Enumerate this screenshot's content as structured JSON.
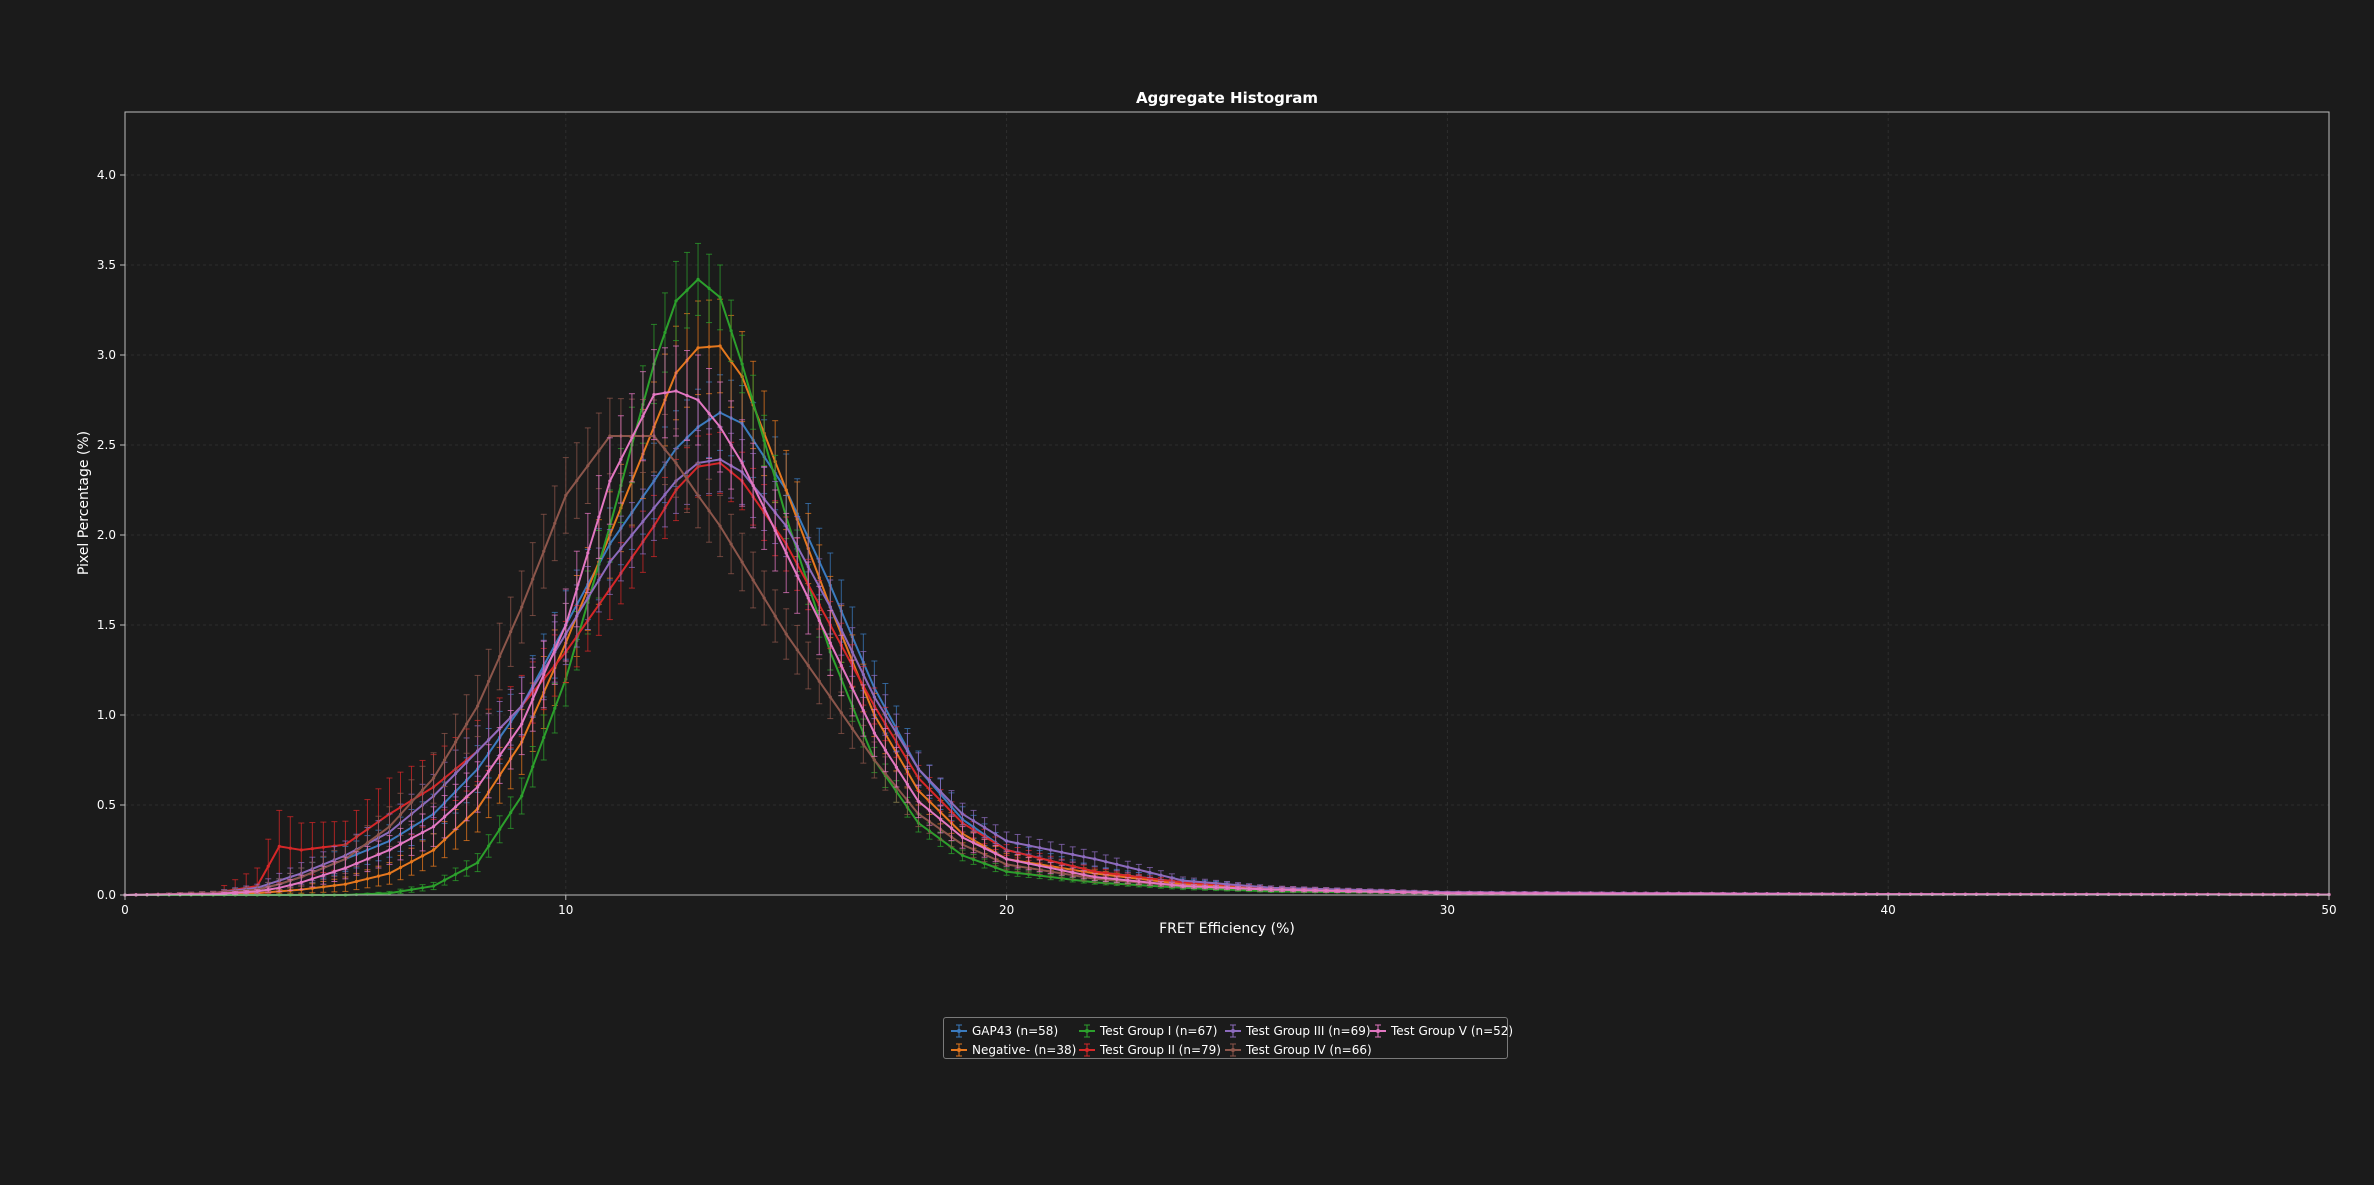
{
  "chart_data": {
    "type": "line",
    "title": "Aggregate Histogram",
    "xlabel": "FRET Efficiency (%)",
    "ylabel": "Pixel Percentage (%)",
    "xlim": [
      0,
      50
    ],
    "ylim": [
      0,
      4.35
    ],
    "xticks": [
      0,
      10,
      20,
      30,
      40,
      50
    ],
    "yticks": [
      0.0,
      0.5,
      1.0,
      1.5,
      2.0,
      2.5,
      3.0,
      3.5,
      4.0
    ],
    "grid": true,
    "legend_position": "bottom-center",
    "x": [
      0,
      2,
      3,
      3.5,
      4,
      5,
      6,
      7,
      8,
      9,
      10,
      11,
      12,
      12.5,
      13,
      13.5,
      14,
      15,
      16,
      17,
      18,
      19,
      20,
      22,
      24,
      26,
      30,
      40,
      50
    ],
    "series": [
      {
        "name": "GAP43 (n=58)",
        "color": "#3b7bbf",
        "values": [
          0,
          0.01,
          0.03,
          0.06,
          0.1,
          0.2,
          0.3,
          0.45,
          0.7,
          1.05,
          1.5,
          1.95,
          2.3,
          2.48,
          2.6,
          2.68,
          2.62,
          2.25,
          1.72,
          1.15,
          0.7,
          0.42,
          0.25,
          0.13,
          0.07,
          0.04,
          0.015,
          0.005,
          0.003
        ],
        "errors": [
          0,
          0.01,
          0.02,
          0.03,
          0.05,
          0.07,
          0.09,
          0.11,
          0.13,
          0.16,
          0.19,
          0.2,
          0.21,
          0.21,
          0.21,
          0.21,
          0.21,
          0.2,
          0.18,
          0.15,
          0.1,
          0.07,
          0.05,
          0.03,
          0.02,
          0.01,
          0.005,
          0.003,
          0.002
        ]
      },
      {
        "name": "Negative- (n=38)",
        "color": "#e6781e",
        "values": [
          0,
          0.005,
          0.01,
          0.02,
          0.03,
          0.06,
          0.12,
          0.25,
          0.48,
          0.85,
          1.4,
          2.0,
          2.6,
          2.9,
          3.04,
          3.05,
          2.88,
          2.25,
          1.6,
          1.0,
          0.58,
          0.34,
          0.2,
          0.12,
          0.06,
          0.03,
          0.01,
          0.005,
          0.003
        ],
        "errors": [
          0,
          0.005,
          0.01,
          0.01,
          0.02,
          0.04,
          0.06,
          0.09,
          0.13,
          0.18,
          0.22,
          0.24,
          0.25,
          0.26,
          0.26,
          0.26,
          0.25,
          0.22,
          0.17,
          0.12,
          0.08,
          0.05,
          0.03,
          0.02,
          0.01,
          0.01,
          0.005,
          0.003,
          0.002
        ]
      },
      {
        "name": "Test Group I (n=67)",
        "color": "#2ca02c",
        "values": [
          0,
          0.0,
          0.0,
          0.0,
          0.0,
          0.0,
          0.01,
          0.05,
          0.18,
          0.55,
          1.2,
          2.05,
          2.95,
          3.3,
          3.42,
          3.32,
          2.95,
          2.1,
          1.35,
          0.75,
          0.4,
          0.22,
          0.13,
          0.07,
          0.04,
          0.02,
          0.01,
          0.004,
          0.002
        ],
        "errors": [
          0,
          0.0,
          0.0,
          0.0,
          0.0,
          0.0,
          0.01,
          0.02,
          0.05,
          0.1,
          0.15,
          0.2,
          0.22,
          0.22,
          0.2,
          0.18,
          0.16,
          0.12,
          0.1,
          0.07,
          0.05,
          0.03,
          0.02,
          0.01,
          0.01,
          0.005,
          0.003,
          0.002,
          0.001
        ]
      },
      {
        "name": "Test Group II (n=79)",
        "color": "#d62728",
        "values": [
          0,
          0.01,
          0.05,
          0.27,
          0.25,
          0.28,
          0.45,
          0.6,
          0.8,
          1.05,
          1.35,
          1.7,
          2.05,
          2.25,
          2.38,
          2.4,
          2.3,
          1.95,
          1.5,
          1.05,
          0.65,
          0.4,
          0.25,
          0.13,
          0.07,
          0.04,
          0.015,
          0.005,
          0.003
        ],
        "errors": [
          0,
          0.01,
          0.1,
          0.2,
          0.15,
          0.13,
          0.2,
          0.18,
          0.17,
          0.17,
          0.17,
          0.17,
          0.17,
          0.17,
          0.17,
          0.17,
          0.16,
          0.15,
          0.13,
          0.1,
          0.07,
          0.05,
          0.03,
          0.02,
          0.01,
          0.01,
          0.005,
          0.003,
          0.002
        ]
      },
      {
        "name": "Test Group III (n=69)",
        "color": "#8c6bbd",
        "values": [
          0,
          0.01,
          0.04,
          0.08,
          0.12,
          0.22,
          0.35,
          0.55,
          0.8,
          1.05,
          1.45,
          1.85,
          2.15,
          2.3,
          2.4,
          2.42,
          2.35,
          2.05,
          1.6,
          1.1,
          0.7,
          0.45,
          0.3,
          0.2,
          0.08,
          0.04,
          0.015,
          0.005,
          0.003
        ],
        "errors": [
          0,
          0.01,
          0.02,
          0.04,
          0.06,
          0.08,
          0.1,
          0.12,
          0.14,
          0.16,
          0.17,
          0.18,
          0.18,
          0.18,
          0.18,
          0.18,
          0.18,
          0.17,
          0.15,
          0.12,
          0.09,
          0.06,
          0.05,
          0.04,
          0.02,
          0.01,
          0.005,
          0.003,
          0.002
        ]
      },
      {
        "name": "Test Group IV (n=66)",
        "color": "#8c564b",
        "values": [
          0,
          0.01,
          0.03,
          0.06,
          0.1,
          0.2,
          0.38,
          0.65,
          1.05,
          1.6,
          2.22,
          2.55,
          2.55,
          2.4,
          2.22,
          2.05,
          1.85,
          1.45,
          1.1,
          0.75,
          0.45,
          0.28,
          0.17,
          0.09,
          0.05,
          0.03,
          0.01,
          0.004,
          0.002
        ],
        "errors": [
          0,
          0.01,
          0.02,
          0.03,
          0.05,
          0.08,
          0.11,
          0.14,
          0.17,
          0.2,
          0.21,
          0.21,
          0.2,
          0.19,
          0.18,
          0.17,
          0.16,
          0.14,
          0.12,
          0.1,
          0.07,
          0.05,
          0.03,
          0.02,
          0.01,
          0.01,
          0.005,
          0.003,
          0.002
        ]
      },
      {
        "name": "Test Group V (n=52)",
        "color": "#e377c2",
        "values": [
          0,
          0.005,
          0.02,
          0.04,
          0.07,
          0.15,
          0.25,
          0.38,
          0.6,
          0.95,
          1.5,
          2.3,
          2.78,
          2.8,
          2.75,
          2.6,
          2.4,
          1.9,
          1.4,
          0.9,
          0.52,
          0.32,
          0.2,
          0.1,
          0.05,
          0.03,
          0.01,
          0.004,
          0.002
        ],
        "errors": [
          0,
          0.005,
          0.01,
          0.02,
          0.04,
          0.06,
          0.08,
          0.11,
          0.14,
          0.17,
          0.2,
          0.24,
          0.25,
          0.25,
          0.25,
          0.25,
          0.24,
          0.22,
          0.18,
          0.13,
          0.09,
          0.06,
          0.04,
          0.02,
          0.01,
          0.01,
          0.005,
          0.003,
          0.002
        ]
      }
    ]
  },
  "colors": {
    "background": "#1b1b1b",
    "axes_frame": "#bdbdbd",
    "grid": "#2e2e2e",
    "text": "#ffffff"
  }
}
